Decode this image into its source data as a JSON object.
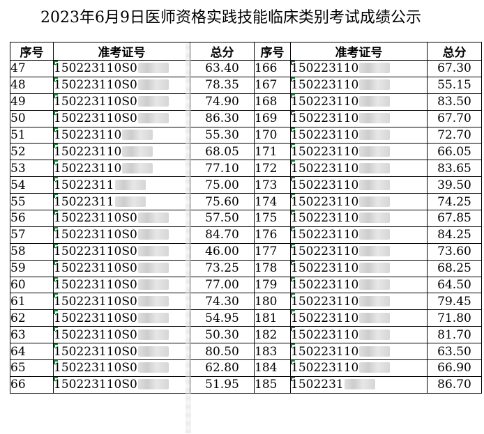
{
  "title": "2023年6月9日医师资格实践技能临床类别考试成绩公示",
  "headers": {
    "seq": "序号",
    "id": "准考证号",
    "score": "总分",
    "seq2": "序号",
    "id2": "准考证号",
    "score2": "总分"
  },
  "rows": [
    {
      "seq": "47",
      "id": "150223110S0",
      "score": "63.40",
      "seq2": "166",
      "id2": "150223110",
      "score2": "67.30"
    },
    {
      "seq": "48",
      "id": "150223110S0",
      "score": "78.35",
      "seq2": "167",
      "id2": "150223110",
      "score2": "55.15"
    },
    {
      "seq": "49",
      "id": "150223110S0",
      "score": "74.90",
      "seq2": "168",
      "id2": "150223110",
      "score2": "83.50"
    },
    {
      "seq": "50",
      "id": "150223110S0",
      "score": "86.30",
      "seq2": "169",
      "id2": "150223110",
      "score2": "67.70"
    },
    {
      "seq": "51",
      "id": "150223110",
      "score": "55.30",
      "seq2": "170",
      "id2": "150223110",
      "score2": "72.70"
    },
    {
      "seq": "52",
      "id": "150223110",
      "score": "68.05",
      "seq2": "171",
      "id2": "150223110",
      "score2": "66.05"
    },
    {
      "seq": "53",
      "id": "150223110",
      "score": "77.10",
      "seq2": "172",
      "id2": "150223110",
      "score2": "83.65"
    },
    {
      "seq": "54",
      "id": "15022311",
      "score": "75.00",
      "seq2": "173",
      "id2": "150223110",
      "score2": "39.50"
    },
    {
      "seq": "55",
      "id": "15022311",
      "score": "75.60",
      "seq2": "174",
      "id2": "150223110",
      "score2": "74.25"
    },
    {
      "seq": "56",
      "id": "150223110S0",
      "score": "57.50",
      "seq2": "175",
      "id2": "150223110",
      "score2": "67.85"
    },
    {
      "seq": "57",
      "id": "150223110S0",
      "score": "84.70",
      "seq2": "176",
      "id2": "150223110",
      "score2": "84.25"
    },
    {
      "seq": "58",
      "id": "150223110S0",
      "score": "46.00",
      "seq2": "177",
      "id2": "150223110",
      "score2": "73.60"
    },
    {
      "seq": "59",
      "id": "150223110S0",
      "score": "73.25",
      "seq2": "178",
      "id2": "150223110",
      "score2": "68.25"
    },
    {
      "seq": "60",
      "id": "150223110S0",
      "score": "77.00",
      "seq2": "179",
      "id2": "150223110",
      "score2": "64.50"
    },
    {
      "seq": "61",
      "id": "150223110S0",
      "score": "74.30",
      "seq2": "180",
      "id2": "150223110",
      "score2": "79.45"
    },
    {
      "seq": "62",
      "id": "150223110S0",
      "score": "54.95",
      "seq2": "181",
      "id2": "150223110",
      "score2": "71.80"
    },
    {
      "seq": "63",
      "id": "150223110S0",
      "score": "50.30",
      "seq2": "182",
      "id2": "150223110",
      "score2": "81.70"
    },
    {
      "seq": "64",
      "id": "150223110S0",
      "score": "80.50",
      "seq2": "183",
      "id2": "150223110",
      "score2": "63.50"
    },
    {
      "seq": "65",
      "id": "150223110S0",
      "score": "62.80",
      "seq2": "184",
      "id2": "150223110",
      "score2": "66.90"
    },
    {
      "seq": "66",
      "id": "150223110S0",
      "score": "51.95",
      "seq2": "185",
      "id2": "1502231",
      "score2": "86.70"
    }
  ]
}
